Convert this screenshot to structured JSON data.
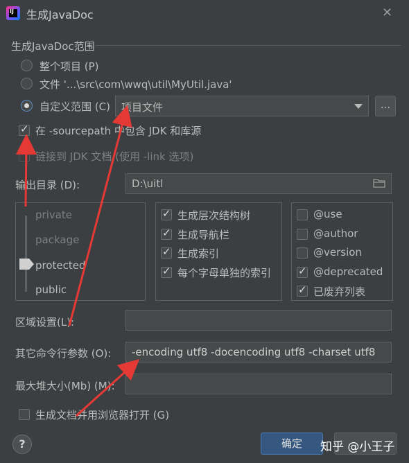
{
  "window": {
    "title": "生成JavaDoc",
    "close_icon": "close-icon"
  },
  "scope": {
    "group_title": "生成JavaDoc范围",
    "whole_project": "整个项目 (P)",
    "file": "文件 '...\\src\\com\\wwq\\util\\MyUtil.java'",
    "custom_scope": "自定义范围 (C)",
    "custom_scope_value": "项目文件",
    "more_button": "...",
    "selected": "custom_scope"
  },
  "options": {
    "include_jdk_sources": "在 -sourcepath 中包含 JDK 和库源",
    "include_jdk_sources_checked": true,
    "link_jdk_docs": "链接到 JDK 文档 (使用 -link 选项)",
    "link_jdk_docs_checked": false
  },
  "output": {
    "label": "输出目录 (D):",
    "value": "D:\\uitl"
  },
  "visibility": {
    "levels": [
      "private",
      "package",
      "protected",
      "public"
    ],
    "selected": "protected"
  },
  "generate": [
    {
      "label": "生成层次结构树",
      "checked": true
    },
    {
      "label": "生成导航栏",
      "checked": true
    },
    {
      "label": "生成索引",
      "checked": true
    },
    {
      "label": "每个字母单独的索引",
      "checked": true
    }
  ],
  "tags": [
    {
      "label": "@use",
      "checked": false
    },
    {
      "label": "@author",
      "checked": false
    },
    {
      "label": "@version",
      "checked": false
    },
    {
      "label": "@deprecated",
      "checked": true
    },
    {
      "label": "已废弃列表",
      "checked": true
    }
  ],
  "locale": {
    "label": "区域设置(L):",
    "value": ""
  },
  "other_args": {
    "label": "其它命令行参数 (O):",
    "value": "-encoding utf8 -docencoding utf8 -charset utf8"
  },
  "max_heap": {
    "label": "最大堆大小(Mb) (M):",
    "value": ""
  },
  "open_browser": {
    "label": "生成文档并用浏览器打开 (G)",
    "checked": false
  },
  "buttons": {
    "help": "?",
    "ok": "确定"
  },
  "watermark": "知乎 @小王子",
  "colors": {
    "background": "#3c3f41",
    "accent": "#365880",
    "annotation_arrow": "#e53935"
  }
}
